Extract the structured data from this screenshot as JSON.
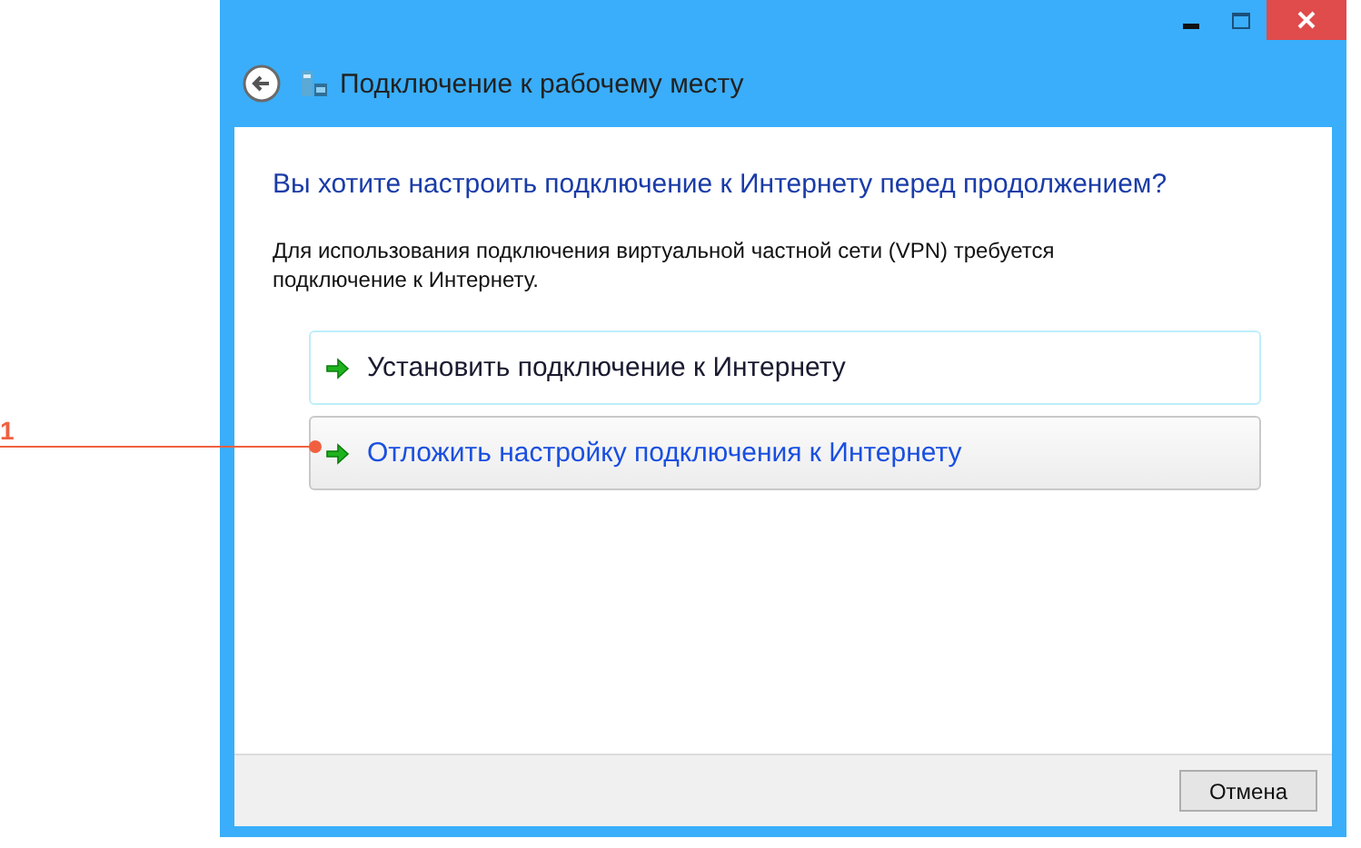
{
  "window": {
    "title": "Подключение к рабочему месту"
  },
  "heading": "Вы хотите настроить подключение к Интернету перед продолжением?",
  "description": "Для использования подключения виртуальной частной сети (VPN) требуется подключение к Интернету.",
  "options": [
    {
      "label": "Установить подключение к Интернету",
      "selected": false
    },
    {
      "label": "Отложить настройку подключения к Интернету",
      "selected": true
    }
  ],
  "callout": {
    "label": "1"
  },
  "buttons": [
    "Отмена"
  ]
}
